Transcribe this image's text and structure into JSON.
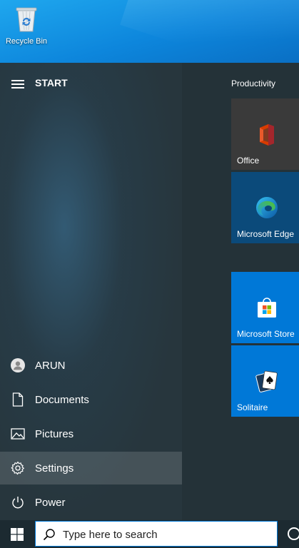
{
  "desktop": {
    "icons": [
      {
        "label": "Recycle Bin",
        "icon": "recycle-bin-icon"
      }
    ]
  },
  "start_menu": {
    "title": "START",
    "items": [
      {
        "label": "ARUN",
        "icon": "user-avatar-icon"
      },
      {
        "label": "Documents",
        "icon": "document-icon"
      },
      {
        "label": "Pictures",
        "icon": "pictures-icon"
      },
      {
        "label": "Settings",
        "icon": "gear-icon",
        "active": true
      },
      {
        "label": "Power",
        "icon": "power-icon"
      }
    ],
    "group_label": "Productivity",
    "tiles": [
      {
        "label": "Office",
        "icon": "office-icon",
        "color": "#3a3a3a"
      },
      {
        "label": "Microsoft Edge",
        "icon": "edge-icon",
        "color": "#0b4a7a"
      },
      {
        "label": "Microsoft Store",
        "icon": "store-icon",
        "color": "#0078d7"
      },
      {
        "label": "Solitaire",
        "icon": "solitaire-icon",
        "color": "#0078d7"
      }
    ]
  },
  "taskbar": {
    "search_placeholder": "Type here to search"
  },
  "colors": {
    "accent": "#0078d7",
    "menu_bg": "#27363d",
    "taskbar_bg": "#1c2a31"
  }
}
